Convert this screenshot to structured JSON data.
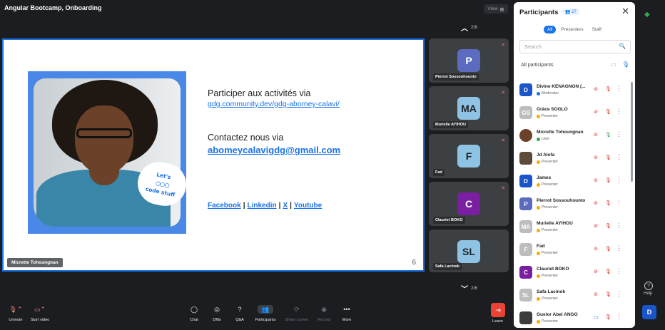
{
  "window": {
    "title": "Angular Bootcamp, Onboarding",
    "view_label": "View"
  },
  "pagination": {
    "top": "2/6",
    "bottom": "2/6"
  },
  "slide": {
    "heading1": "Participer aux activités via",
    "link1": "gdg.community.dev/gdg-abomey-calavi/",
    "heading2": "Contactez nous via",
    "email": "abomeycalavigdg@gmail.com",
    "social": {
      "facebook": "Facebook",
      "linkedin": "Linkedin",
      "x": "X",
      "youtube": "Youtube",
      "sep": "|"
    },
    "sticker_line1": "Let's",
    "sticker_line2": "code stuff",
    "slide_number": "6",
    "presenter_name": "Micrette Tohoungnan"
  },
  "tiles": [
    {
      "initials": "P",
      "name": "Pierrot Sossouhounto",
      "color": "#5c6bc0"
    },
    {
      "initials": "MA",
      "name": "Murielle AYIHOU",
      "color": "#8fc3e4"
    },
    {
      "initials": "F",
      "name": "Fad",
      "color": "#8fc3e4"
    },
    {
      "initials": "C",
      "name": "Clauriet BOKO",
      "color": "#7b1fa2"
    },
    {
      "initials": "SL",
      "name": "Safa Lacinok",
      "color": "#8fc3e4"
    }
  ],
  "panel": {
    "title": "Participants",
    "count": "27",
    "filters": [
      "All",
      "Presenters",
      "Staff"
    ],
    "search_placeholder": "Search",
    "all_participants": "All participants",
    "participants": [
      {
        "initials": "D",
        "name": "Divine KENAGNON (...",
        "role": "Moderator",
        "color": "#1a56c9",
        "roleType": "mod"
      },
      {
        "initials": "GS",
        "name": "Grâce SOGLO",
        "role": "Presenter",
        "color": "#bdbdbd",
        "roleType": "pres"
      },
      {
        "initials": "",
        "name": "Micrette Tohoungnan",
        "role": "User",
        "color": "#6b4229",
        "roleType": "usr"
      },
      {
        "initials": "",
        "name": "Jd Alofa",
        "role": "Presenter",
        "color": "#5d4a3a",
        "roleType": "pres"
      },
      {
        "initials": "D",
        "name": "James",
        "role": "Presenter",
        "color": "#1a56c9",
        "roleType": "pres"
      },
      {
        "initials": "P",
        "name": "Pierrot Sossouhounto",
        "role": "Presenter",
        "color": "#5c6bc0",
        "roleType": "pres"
      },
      {
        "initials": "MA",
        "name": "Murielle AYIHOU",
        "role": "Presenter",
        "color": "#bdbdbd",
        "roleType": "pres"
      },
      {
        "initials": "F",
        "name": "Fad",
        "role": "Presenter",
        "color": "#bdbdbd",
        "roleType": "pres"
      },
      {
        "initials": "C",
        "name": "Clauriet BOKO",
        "role": "Presenter",
        "color": "#7b1fa2",
        "roleType": "pres"
      },
      {
        "initials": "SL",
        "name": "Safa Lacinok",
        "role": "Presenter",
        "color": "#bdbdbd",
        "roleType": "pres"
      },
      {
        "initials": "",
        "name": "Guelor Abel ANGO",
        "role": "Presenter",
        "color": "#3c3c3c",
        "roleType": "pres"
      }
    ]
  },
  "rail": {
    "help_label": "Help",
    "avatar": "D"
  },
  "toolbar": {
    "unmute": "Unmute",
    "start_video": "Start video",
    "chat": "Chat",
    "dms": "DMs",
    "qa": "Q&A",
    "participants": "Participants",
    "participants_badge": "27",
    "share_screen": "Share screen",
    "record": "Record",
    "more": "More",
    "leave": "Leave"
  }
}
